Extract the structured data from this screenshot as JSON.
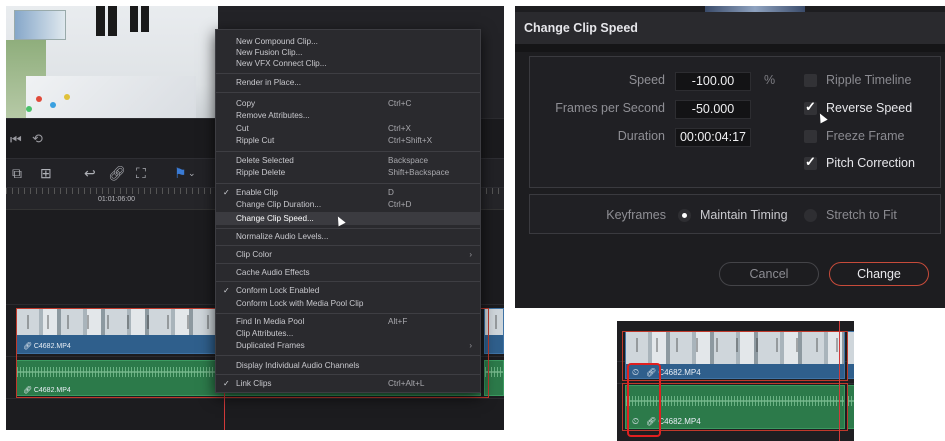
{
  "context_menu": {
    "items": [
      {
        "label": "New Compound Clip...",
        "shortcut": "",
        "checked": false,
        "submenu": false
      },
      {
        "label": "New Fusion Clip...",
        "shortcut": "",
        "checked": false,
        "submenu": false
      },
      {
        "label": "New VFX Connect Clip...",
        "shortcut": "",
        "checked": false,
        "submenu": false
      },
      {
        "label": "Render in Place...",
        "shortcut": "",
        "checked": false,
        "submenu": false
      },
      {
        "label": "Copy",
        "shortcut": "Ctrl+C",
        "checked": false,
        "submenu": false
      },
      {
        "label": "Remove Attributes...",
        "shortcut": "",
        "checked": false,
        "submenu": false
      },
      {
        "label": "Cut",
        "shortcut": "Ctrl+X",
        "checked": false,
        "submenu": false
      },
      {
        "label": "Ripple Cut",
        "shortcut": "Ctrl+Shift+X",
        "checked": false,
        "submenu": false
      },
      {
        "label": "Delete Selected",
        "shortcut": "Backspace",
        "checked": false,
        "submenu": false
      },
      {
        "label": "Ripple Delete",
        "shortcut": "Shift+Backspace",
        "checked": false,
        "submenu": false
      },
      {
        "label": "Enable Clip",
        "shortcut": "D",
        "checked": true,
        "submenu": false
      },
      {
        "label": "Change Clip Duration...",
        "shortcut": "Ctrl+D",
        "checked": false,
        "submenu": false
      },
      {
        "label": "Change Clip Speed...",
        "shortcut": "",
        "checked": false,
        "submenu": false,
        "highlighted": true
      },
      {
        "label": "Normalize Audio Levels...",
        "shortcut": "",
        "checked": false,
        "submenu": false
      },
      {
        "label": "Clip Color",
        "shortcut": "",
        "checked": false,
        "submenu": true
      },
      {
        "label": "Cache Audio Effects",
        "shortcut": "",
        "checked": false,
        "submenu": false
      },
      {
        "label": "Conform Lock Enabled",
        "shortcut": "",
        "checked": true,
        "submenu": false
      },
      {
        "label": "Conform Lock with Media Pool Clip",
        "shortcut": "",
        "checked": false,
        "submenu": false
      },
      {
        "label": "Find In Media Pool",
        "shortcut": "Alt+F",
        "checked": false,
        "submenu": false
      },
      {
        "label": "Clip Attributes...",
        "shortcut": "",
        "checked": false,
        "submenu": false
      },
      {
        "label": "Duplicated Frames",
        "shortcut": "",
        "checked": false,
        "submenu": true
      },
      {
        "label": "Display Individual Audio Channels",
        "shortcut": "",
        "checked": false,
        "submenu": false
      },
      {
        "label": "Link Clips",
        "shortcut": "Ctrl+Alt+L",
        "checked": true,
        "submenu": false
      }
    ]
  },
  "timeline": {
    "ruler_timecode": "01:01:06:00",
    "video_clip_name": "C4682.MP4",
    "audio_clip_name": "C4682.MP4"
  },
  "dialog": {
    "title": "Change Clip Speed",
    "speed_label": "Speed",
    "speed_value": "-100.00",
    "speed_unit": "%",
    "fps_label": "Frames per Second",
    "fps_value": "-50.000",
    "duration_label": "Duration",
    "duration_value": "00:00:04:17",
    "options": [
      {
        "label": "Ripple Timeline",
        "checked": false
      },
      {
        "label": "Reverse Speed",
        "checked": true
      },
      {
        "label": "Freeze Frame",
        "checked": false
      },
      {
        "label": "Pitch Correction",
        "checked": true
      }
    ],
    "keyframes_label": "Keyframes",
    "keyframe_modes": [
      {
        "label": "Maintain Timing",
        "selected": true
      },
      {
        "label": "Stretch to Fit",
        "selected": false
      }
    ],
    "cancel_label": "Cancel",
    "change_label": "Change"
  },
  "zoom_timeline": {
    "video_clip_name": "C4682.MP4",
    "audio_clip_name": "C4682.MP4"
  },
  "colors": {
    "video_clip": "#2f5f8c",
    "audio_clip": "#2c7a4a",
    "highlight_red": "#c0392b",
    "change_button_border": "#c74b3a",
    "menu_bg": "#2a2a2e",
    "dialog_bg": "#1d1d20"
  }
}
